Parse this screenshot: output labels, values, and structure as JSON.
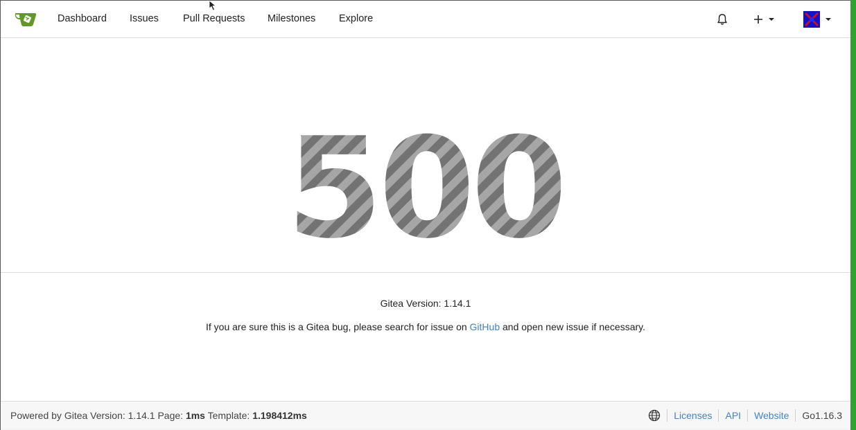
{
  "navbar": {
    "items": [
      {
        "label": "Dashboard"
      },
      {
        "label": "Issues"
      },
      {
        "label": "Pull Requests"
      },
      {
        "label": "Milestones"
      },
      {
        "label": "Explore"
      }
    ]
  },
  "error": {
    "code": "500",
    "version_text": "Gitea Version: 1.14.1",
    "help_prefix": "If you are sure this is a Gitea bug, please search for issue on ",
    "help_link": "GitHub",
    "help_suffix": " and open new issue if necessary."
  },
  "footer": {
    "powered_prefix": "Powered by Gitea Version: 1.14.1 Page: ",
    "page_time": "1ms",
    "template_label": " Template: ",
    "template_time": "1.198412ms",
    "links": [
      "Licenses",
      "API",
      "Website"
    ],
    "go_version": "Go1.16.3"
  },
  "colors": {
    "brand": "#609926",
    "link": "#4183c4",
    "stripe_light": "#a6a6a6",
    "stripe_dark": "#737373"
  }
}
